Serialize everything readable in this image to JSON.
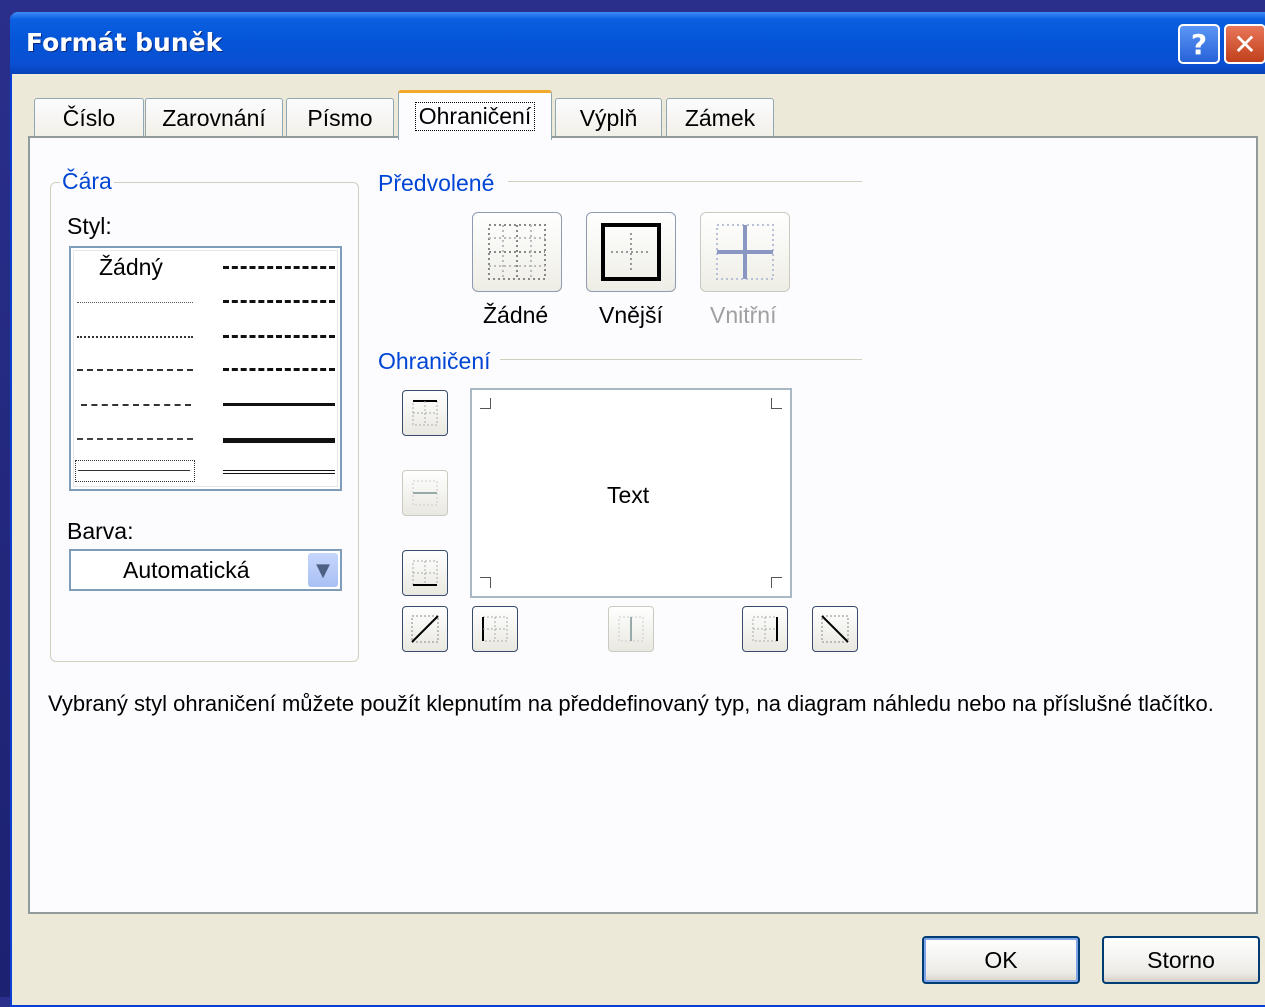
{
  "window": {
    "title": "Formát buněk"
  },
  "tabs": [
    {
      "label": "Číslo"
    },
    {
      "label": "Zarovnání"
    },
    {
      "label": "Písmo"
    },
    {
      "label": "Ohraničení",
      "active": true
    },
    {
      "label": "Výplň"
    },
    {
      "label": "Zámek"
    }
  ],
  "line_group": {
    "title": "Čára",
    "style_label": "Styl:",
    "style_none": "Žádný",
    "color_label": "Barva:",
    "color_value": "Automatická"
  },
  "presets": {
    "title": "Předvolené",
    "items": [
      {
        "label": "Žádné",
        "enabled": true
      },
      {
        "label": "Vnější",
        "enabled": true
      },
      {
        "label": "Vnitřní",
        "enabled": false
      }
    ]
  },
  "border": {
    "title": "Ohraničení",
    "preview_text": "Text"
  },
  "hint": "Vybraný styl ohraničení můžete použít klepnutím na předdefinovaný typ, na diagram náhledu nebo na příslušné tlačítko.",
  "buttons": {
    "ok": "OK",
    "cancel": "Storno"
  },
  "colors": {
    "accent_tab": "#f0a92a",
    "group_title": "#0046d5",
    "title_bar": "#0554d7"
  }
}
